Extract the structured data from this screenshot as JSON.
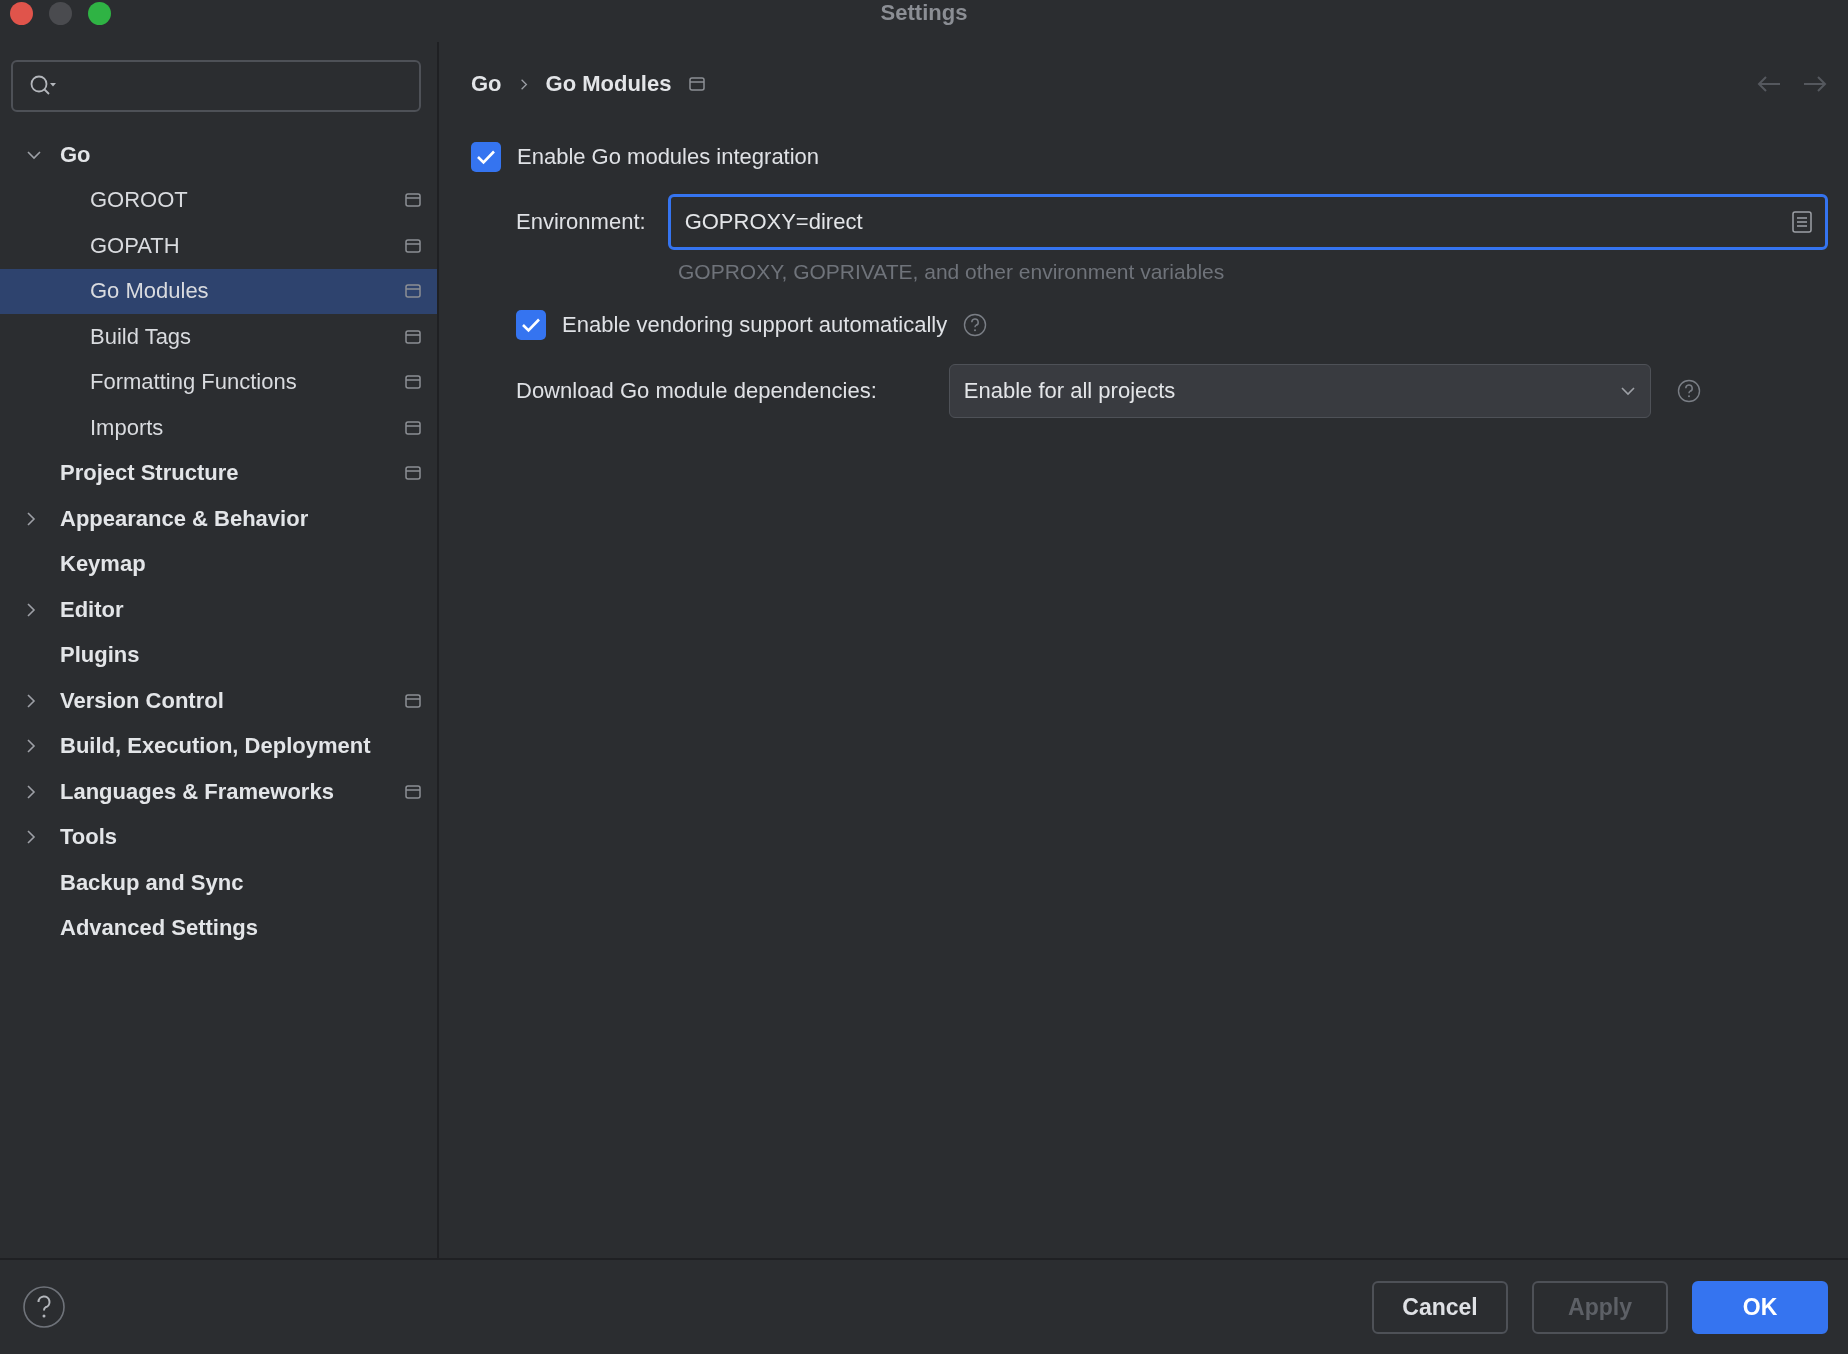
{
  "window": {
    "title": "Settings"
  },
  "sidebar": {
    "items": [
      {
        "label": "Go",
        "expanded": true,
        "selected": false,
        "project_level": false,
        "children": [
          {
            "label": "GOROOT",
            "selected": false,
            "project_level": true
          },
          {
            "label": "GOPATH",
            "selected": false,
            "project_level": true
          },
          {
            "label": "Go Modules",
            "selected": true,
            "project_level": true
          },
          {
            "label": "Build Tags",
            "selected": false,
            "project_level": true
          },
          {
            "label": "Formatting Functions",
            "selected": false,
            "project_level": true
          },
          {
            "label": "Imports",
            "selected": false,
            "project_level": true
          }
        ]
      },
      {
        "label": "Project Structure",
        "selected": false,
        "project_level": true
      },
      {
        "label": "Appearance & Behavior",
        "expanded": false,
        "selected": false,
        "project_level": false
      },
      {
        "label": "Keymap",
        "selected": false,
        "project_level": false
      },
      {
        "label": "Editor",
        "expanded": false,
        "selected": false,
        "project_level": false
      },
      {
        "label": "Plugins",
        "selected": false,
        "project_level": false
      },
      {
        "label": "Version Control",
        "expanded": false,
        "selected": false,
        "project_level": true
      },
      {
        "label": "Build, Execution, Deployment",
        "expanded": false,
        "selected": false,
        "project_level": false
      },
      {
        "label": "Languages & Frameworks",
        "expanded": false,
        "selected": false,
        "project_level": true
      },
      {
        "label": "Tools",
        "expanded": false,
        "selected": false,
        "project_level": false
      },
      {
        "label": "Backup and Sync",
        "selected": false,
        "project_level": false
      },
      {
        "label": "Advanced Settings",
        "selected": false,
        "project_level": false
      }
    ]
  },
  "breadcrumb": [
    "Go",
    "Go Modules"
  ],
  "form": {
    "modules_integration": {
      "label": "Enable Go modules integration",
      "checked": true
    },
    "environment": {
      "label": "Environment:",
      "value": "GOPROXY=direct",
      "hint": "GOPROXY, GOPRIVATE, and other environment variables"
    },
    "vendoring": {
      "label": "Enable vendoring support automatically",
      "checked": true
    },
    "download": {
      "label": "Download Go module dependencies:",
      "value": "Enable for all projects"
    }
  },
  "footer": {
    "buttons": [
      {
        "label": "Cancel",
        "kind": "default",
        "disabled": false
      },
      {
        "label": "Apply",
        "kind": "default",
        "disabled": true
      },
      {
        "label": "OK",
        "kind": "primary",
        "disabled": false
      }
    ]
  }
}
